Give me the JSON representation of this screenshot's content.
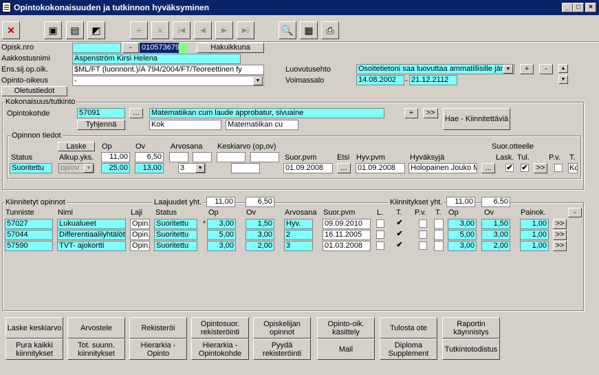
{
  "window": {
    "title": "Opintokokonaisuuden ja tutkinnon hyväksyminen",
    "min": "_",
    "max": "□",
    "close": "×"
  },
  "toolbar": {
    "close": "✕",
    "b2": "▣",
    "save": "▤",
    "export": "◩",
    "new": "+",
    "delete": "×",
    "first": "|◀",
    "prev": "◀",
    "next": "▶",
    "last": "▶|",
    "search": "🔍",
    "notes": "▦",
    "print": "⎙"
  },
  "student": {
    "opisk_label": "Opisk.nro",
    "opisk_value": "",
    "dash": "-",
    "opisk_id": "010573679",
    "hakuikkuna": "Hakuikkuna",
    "aakkostus_label": "Aakkostusnimi",
    "aakkostus_value": "Aspenström Kirsi Helena",
    "ens_label": "Ens.sij.op.oik.",
    "ens_value": "$ML/FT (luonnont.)/A 794/2004/FT/Teoreettinen fy",
    "oikeus_label": "Opinto-oikeus",
    "oikeus_value": "-",
    "oletustiedot": "Oletustiedot",
    "luovutus_label": "Luovutusehto",
    "luovutus_value": "Osoitetietoni saa luovuttaa ammatillisille järje",
    "voimassa_label": "Voimassalo",
    "voimassa_from": "14.08.2002",
    "voimassa_dash": "-",
    "voimassa_to": "21.12.2112",
    "plus": "+",
    "minus": "-"
  },
  "kokonaisuus": {
    "group_label": "Kokonaisuus/tutkinto",
    "opintokohde_label": "Opintokohde",
    "code": "57091",
    "dots": "...",
    "name": "Matematiikan cum laude approbatur, sivuaine",
    "tyhjenna": "Tyhjennä",
    "short1": "Kok",
    "short2": "Matematiikan cu",
    "plus": "+",
    "arrow": ">>",
    "hae": "Hae - Kiinnitettäviä"
  },
  "tiedot": {
    "group_label": "Opinnon tiedot",
    "laske": "Laske",
    "h_op": "Op",
    "h_ov": "Ov",
    "h_arvosana": "Arvosana",
    "h_keskiarvo": "Keskiarvo (op,ov)",
    "h_status": "Status",
    "h_alkup": "Alkup.yks.",
    "op_val": "11,00",
    "ov_val": "6,50",
    "status": "Suoritettu",
    "alkup": "op/ov",
    "op2": "25,00",
    "ov2": "13,00",
    "arvosana": "3",
    "h_suor": "Suor.pvm",
    "suor": "01.09.2008",
    "h_etsi": "Etsi",
    "etsi_btn": "...",
    "h_hyv": "Hyv.pvm",
    "hyv": "01.09.2008",
    "h_hyvaksyja": "Hyväksyjä",
    "hyvaksyja": "Holopainen Jouko M",
    "hyv_btn": "...",
    "h_suorote": "Suor.otteelle",
    "h_lask": "Lask.",
    "h_tul": "Tul.",
    "h_pv": "P.v.",
    "h_t": "T.",
    "arrow": ">>",
    "t_val": "Kc",
    "lask_checked": "✔",
    "tul_checked": "✔"
  },
  "kiinnitetyt": {
    "group_label": "Kiinnitetyt opinnot",
    "laajuudet": "Laajuudet yht.",
    "laaj_op": "11,00",
    "laaj_ov": "6,50",
    "kiinnitykset": "Kiinnitykset yht.",
    "kiin_op": "11,00",
    "kiin_ov": "6,50",
    "minus": "-",
    "headers": {
      "tunniste": "Tunniste",
      "nimi": "Nimi",
      "laji": "Laji",
      "status": "Status",
      "op": "Op",
      "ov": "Ov",
      "arvosana": "Arvosana",
      "suor": "Suor.pvm",
      "l": "L.",
      "t": "T.",
      "pv": "P.v.",
      "t2": "T.",
      "op2": "Op",
      "ov2": "Ov",
      "painok": "Painok."
    },
    "rows": [
      {
        "tunniste": "57027",
        "nimi": "Lukualueet",
        "laji": "Opin.",
        "status": "Suoritettu",
        "mark": "*",
        "op": "3,00",
        "ov": "1,50",
        "arvosana": "Hyv.",
        "suor": "09.09.2010",
        "t": "✔",
        "op2": "3,00",
        "ov2": "1,50",
        "painok": "1,00",
        "arrow": ">>"
      },
      {
        "tunniste": "57044",
        "nimi": "Differentiaalilyhtälöt",
        "laji": "Opin.",
        "status": "Suoritettu",
        "mark": "",
        "op": "5,00",
        "ov": "3,00",
        "arvosana": "2",
        "suor": "16.11.2005",
        "t": "✔",
        "op2": "5,00",
        "ov2": "3,00",
        "painok": "1,00",
        "arrow": ">>"
      },
      {
        "tunniste": "57590",
        "nimi": "TVT- ajokortti",
        "laji": "Opin.",
        "status": "Suoritettu",
        "mark": "",
        "op": "3,00",
        "ov": "2,00",
        "arvosana": "3",
        "suor": "01.03.2008",
        "t": "✔",
        "op2": "3,00",
        "ov2": "2,00",
        "painok": "1,00",
        "arrow": ">>"
      }
    ]
  },
  "buttons": {
    "laske_keskiarvo": "Laske keskiarvo",
    "arvostele": "Arvostele",
    "rekisteroi": "Rekisteröi",
    "opintosuor": "Opintosuor. rekisteröinti",
    "opiskelijan": "Opiskelijan opinnot",
    "opinto_oik": "Opinto-oik. käsittely",
    "tulosta": "Tulosta ote",
    "raportin": "Raportin käynnistys",
    "pura": "Pura kaikki kiinnitykset",
    "tot": "Tot. suunn. kiinnitykset",
    "hier_opinto": "Hierarkia - Opinto",
    "hier_kohde": "Hierarkia - Opintokohde",
    "pyyda": "Pyydä rekisteröinti",
    "mail": "Mail",
    "diploma": "Diploma Supplement",
    "tutkinto": "Tutkintotodistus"
  }
}
